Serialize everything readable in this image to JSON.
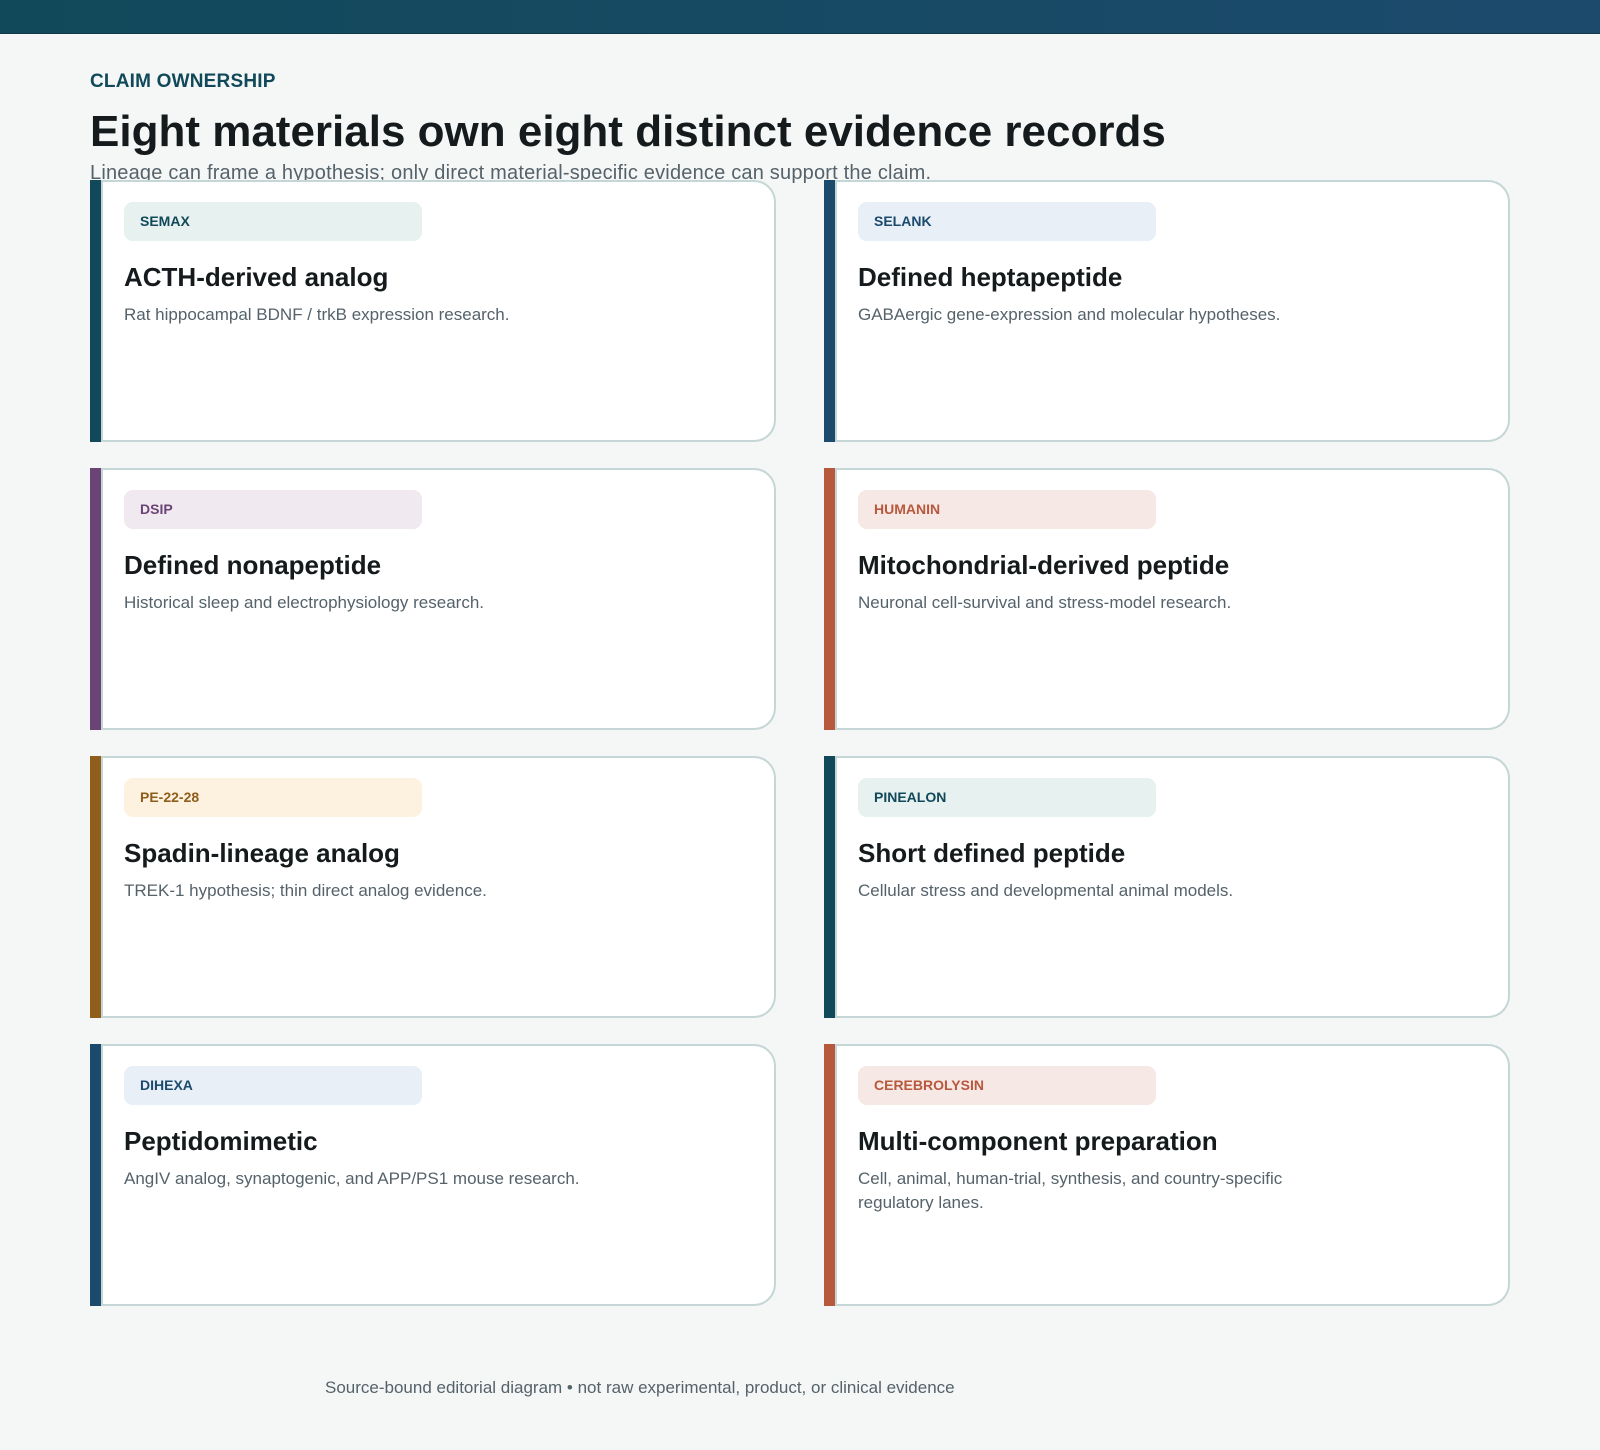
{
  "header": {
    "eyebrow": "CLAIM OWNERSHIP",
    "title": "Eight materials own eight distinct evidence records",
    "subtitle": "Lineage can frame a hypothesis; only direct material-specific evidence can support the claim."
  },
  "cards": [
    {
      "tag": "SEMAX",
      "title": "ACTH-derived analog",
      "desc": "Rat hippocampal BDNF / trkB expression research.",
      "accent": "#11495a",
      "tag_bg": "#e7f1ef",
      "tag_color": "#11495a"
    },
    {
      "tag": "SELANK",
      "title": "Defined heptapeptide",
      "desc": "GABAergic gene-expression and molecular hypotheses.",
      "accent": "#1c4a6d",
      "tag_bg": "#e8eff6",
      "tag_color": "#1c4a6d"
    },
    {
      "tag": "DSIP",
      "title": "Defined nonapeptide",
      "desc": "Historical sleep and electrophysiology research.",
      "accent": "#6b4476",
      "tag_bg": "#f0e9f0",
      "tag_color": "#6b4476"
    },
    {
      "tag": "HUMANIN",
      "title": "Mitochondrial-derived peptide",
      "desc": "Neuronal cell-survival and stress-model research.",
      "accent": "#b8583d",
      "tag_bg": "#f6e8e5",
      "tag_color": "#b8583d"
    },
    {
      "tag": "PE-22-28",
      "title": "Spadin-lineage analog",
      "desc": "TREK-1 hypothesis; thin direct analog evidence.",
      "accent": "#8f5d1c",
      "tag_bg": "#fdf2e0",
      "tag_color": "#8f5d1c"
    },
    {
      "tag": "PINEALON",
      "title": "Short defined peptide",
      "desc": "Cellular stress and developmental animal models.",
      "accent": "#11495a",
      "tag_bg": "#e7f1ef",
      "tag_color": "#11495a"
    },
    {
      "tag": "DIHEXA",
      "title": "Peptidomimetic",
      "desc": "AngIV analog, synaptogenic, and APP/PS1 mouse research.",
      "accent": "#1c4a6d",
      "tag_bg": "#e8eff6",
      "tag_color": "#1c4a6d"
    },
    {
      "tag": "CEREBROLYSIN",
      "title": "Multi-component preparation",
      "desc": "Cell, animal, human-trial, synthesis, and country-specific regulatory lanes.",
      "accent": "#b8583d",
      "tag_bg": "#f6e8e5",
      "tag_color": "#b8583d"
    }
  ],
  "footnote": "Source-bound editorial diagram • not raw experimental, product, or clinical evidence"
}
